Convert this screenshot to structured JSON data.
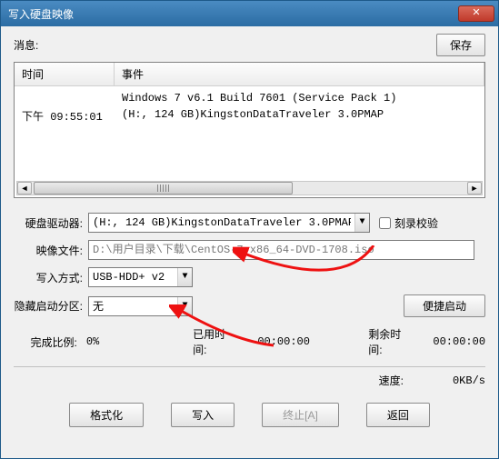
{
  "window": {
    "title": "写入硬盘映像"
  },
  "top": {
    "message_label": "消息:",
    "save_button": "保存"
  },
  "log": {
    "header_time": "时间",
    "header_event": "事件",
    "rows": [
      {
        "time": "",
        "event": "Windows 7 v6.1 Build 7601 (Service Pack 1)"
      },
      {
        "time": "下午 09:55:01",
        "event": "(H:, 124 GB)KingstonDataTraveler 3.0PMAP"
      }
    ]
  },
  "form": {
    "drive_label": "硬盘驱动器:",
    "drive_value": "(H:, 124 GB)KingstonDataTraveler 3.0PMAP",
    "verify_label": "刻录校验",
    "image_label": "映像文件:",
    "image_value": "D:\\用户目录\\下载\\CentOS-7-x86_64-DVD-1708.iso",
    "write_mode_label": "写入方式:",
    "write_mode_value": "USB-HDD+ v2",
    "hidden_label": "隐藏启动分区:",
    "hidden_value": "无",
    "convenient_button": "便捷启动"
  },
  "stats": {
    "progress_label": "完成比例:",
    "progress_value": "0%",
    "elapsed_label": "已用时间:",
    "elapsed_value": "00:00:00",
    "remaining_label": "剩余时间:",
    "remaining_value": "00:00:00",
    "speed_label": "速度:",
    "speed_value": "0KB/s"
  },
  "buttons": {
    "format": "格式化",
    "write": "写入",
    "abort": "终止[A]",
    "return": "返回"
  }
}
